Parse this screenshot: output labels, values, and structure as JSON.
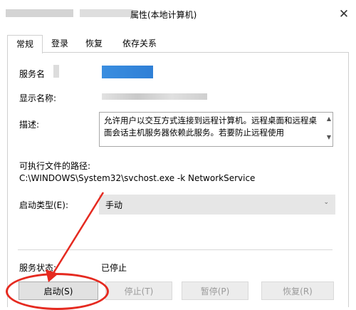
{
  "window": {
    "title": "属性(本地计算机)",
    "close_glyph": "✕"
  },
  "tabs": [
    {
      "label": "常规",
      "active": true
    },
    {
      "label": "登录",
      "active": false
    },
    {
      "label": "恢复",
      "active": false
    },
    {
      "label": "依存关系",
      "active": false
    }
  ],
  "general": {
    "service_name_label": "服务名",
    "display_name_label": "显示名称:",
    "description_label": "描述:",
    "description_text": "允许用户以交互方式连接到远程计算机。远程桌面和远程桌面会话主机服务器依赖此服务。若要防止远程使用",
    "path_label": "可执行文件的路径:",
    "path_value": "C:\\WINDOWS\\System32\\svchost.exe -k NetworkService",
    "startup_type_label": "启动类型(E):",
    "startup_type_value": "手动",
    "service_status_label": "服务状态:",
    "service_status_value": "已停止"
  },
  "buttons": {
    "start": "启动(S)",
    "stop": "停止(T)",
    "pause": "暂停(P)",
    "resume": "恢复(R)"
  },
  "colors": {
    "annotation": "#e52a20",
    "blur_blue": "#3a8ee0"
  }
}
